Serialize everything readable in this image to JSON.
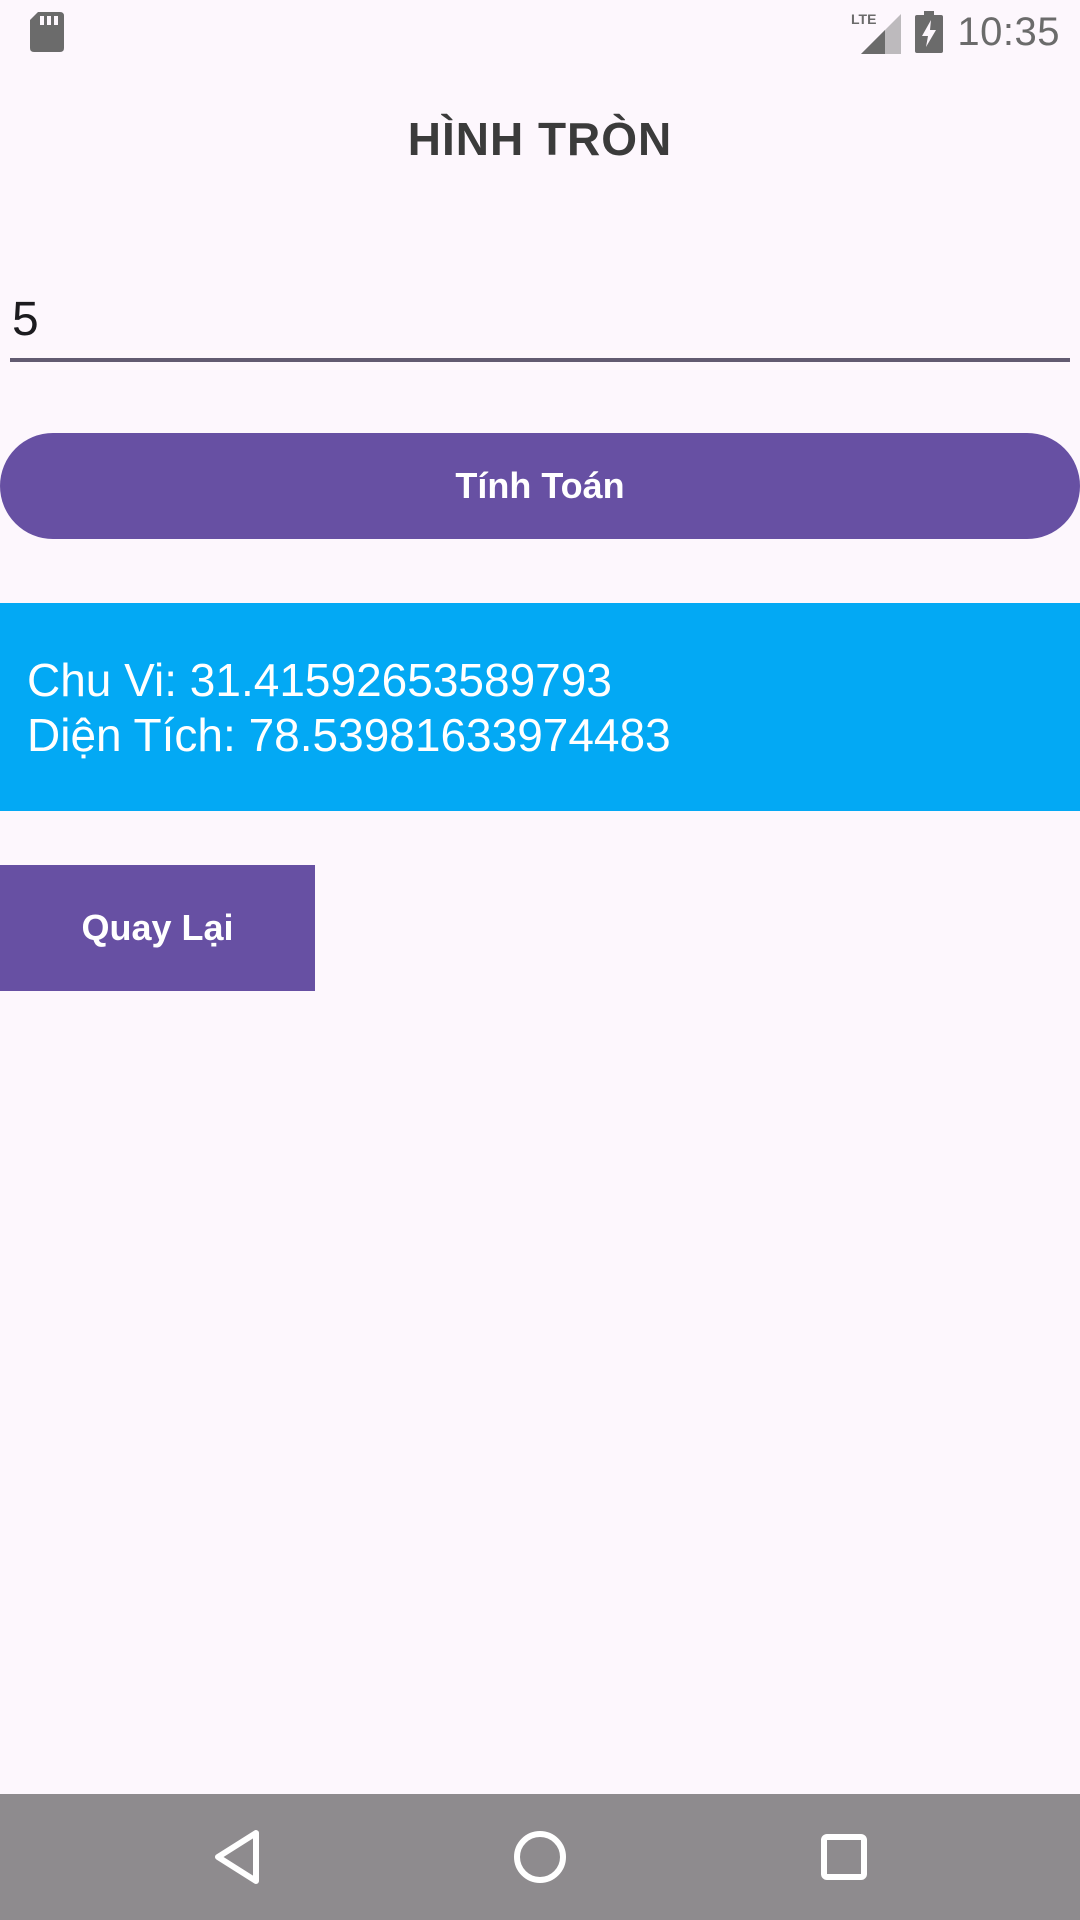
{
  "status_bar": {
    "time": "10:35",
    "network_label": "LTE",
    "icons": [
      "sd-card-icon",
      "lte-signal-icon",
      "battery-charging-icon"
    ]
  },
  "title": "HÌNH TRÒN",
  "input": {
    "value": "5"
  },
  "calculate_button": {
    "label": "Tính Toán"
  },
  "result": {
    "circumference": "Chu Vi: 31.41592653589793",
    "area": "Diện Tích: 78.53981633974483"
  },
  "back_button": {
    "label": "Quay Lại"
  },
  "nav_bar": {
    "icons": [
      "back-triangle-icon",
      "home-circle-icon",
      "recents-square-icon"
    ]
  },
  "colors": {
    "background": "#fdf7fd",
    "primary": "#6750a3",
    "result_bg": "#03a9f4",
    "nav_bar": "#8e8b8e"
  }
}
